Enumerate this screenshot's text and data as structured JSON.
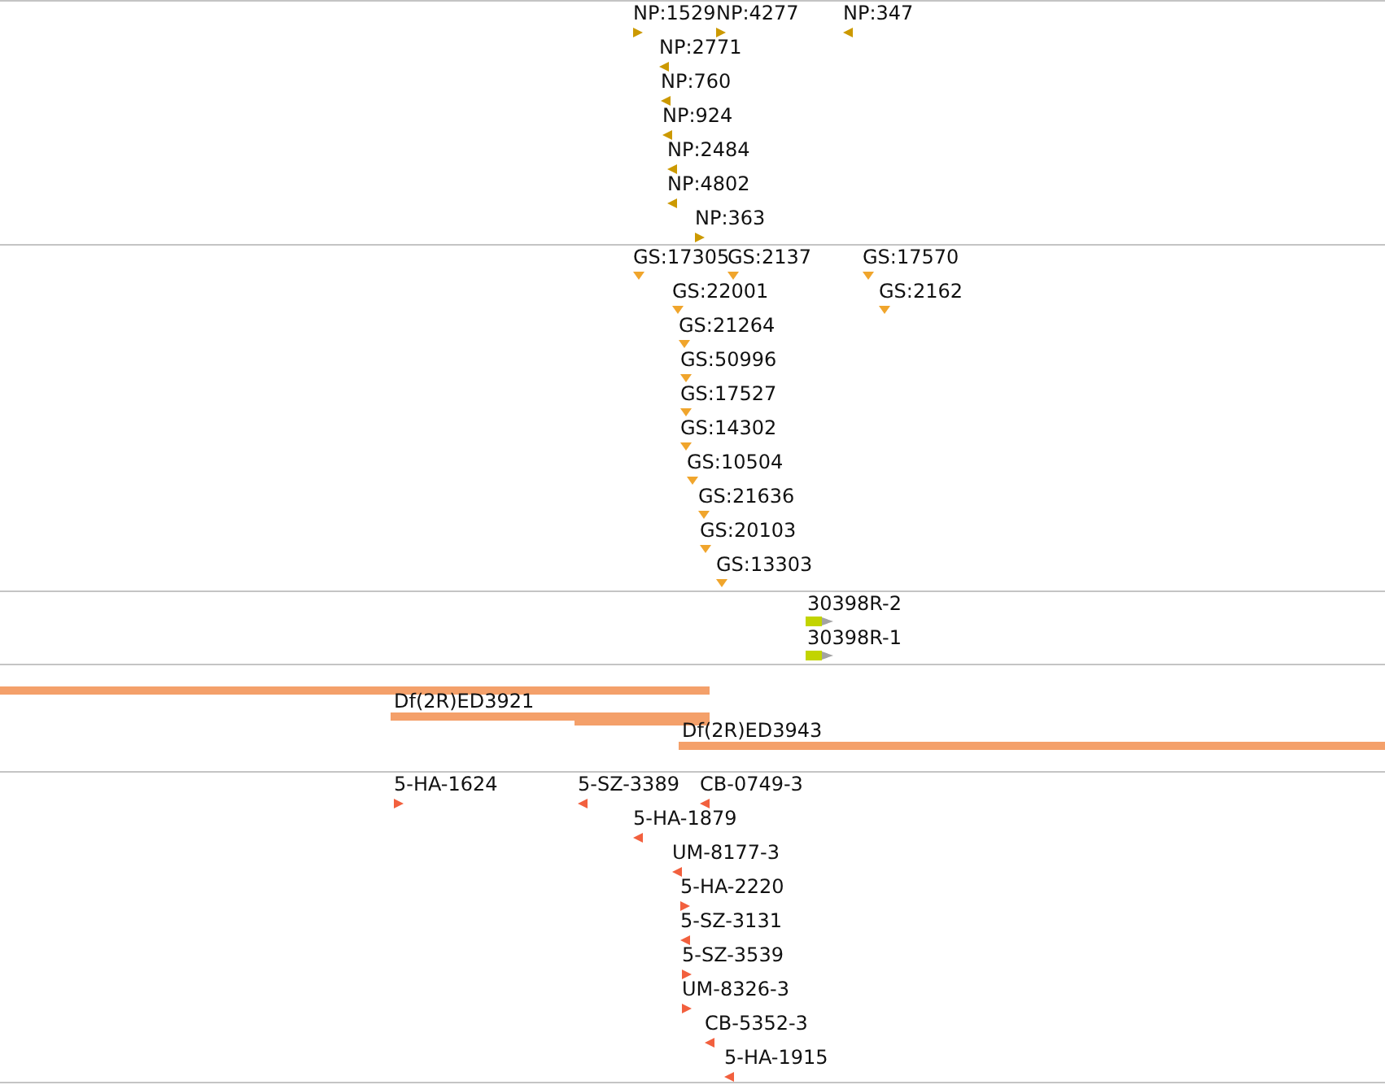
{
  "tracks": [
    {
      "kind": "stranded",
      "color": "#cc9900",
      "features": [
        {
          "label": "NP:1529",
          "reverse": false
        },
        {
          "label": "NP:4277",
          "reverse": false
        },
        {
          "label": "NP:347",
          "reverse": true
        },
        {
          "label": "NP:2771",
          "reverse": true
        },
        {
          "label": "NP:760",
          "reverse": true
        },
        {
          "label": "NP:924",
          "reverse": true
        },
        {
          "label": "NP:2484",
          "reverse": true
        },
        {
          "label": "NP:4802",
          "reverse": true
        },
        {
          "label": "NP:363",
          "reverse": false
        }
      ]
    },
    {
      "kind": "point",
      "color": "#f0a52c",
      "features": [
        {
          "label": "GS:17305"
        },
        {
          "label": "GS:2137"
        },
        {
          "label": "GS:17570"
        },
        {
          "label": "GS:22001"
        },
        {
          "label": "GS:2162"
        },
        {
          "label": "GS:21264"
        },
        {
          "label": "GS:50996"
        },
        {
          "label": "GS:17527"
        },
        {
          "label": "GS:14302"
        },
        {
          "label": "GS:10504"
        },
        {
          "label": "GS:21636"
        },
        {
          "label": "GS:20103"
        },
        {
          "label": "GS:13303"
        }
      ]
    },
    {
      "kind": "gene",
      "color": "#c2d400",
      "features": [
        {
          "label": "30398R-2",
          "reverse": false
        },
        {
          "label": "30398R-1",
          "reverse": false
        }
      ]
    },
    {
      "kind": "span",
      "color": "#f4a06a",
      "features": [
        {
          "kind": "bar"
        },
        {
          "kind": "bar",
          "label": "Df(2R)ED3921"
        },
        {
          "kind": "bar"
        },
        {
          "kind": "bar",
          "label": "Df(2R)ED3943"
        }
      ]
    },
    {
      "kind": "stranded",
      "color": "#f2603e",
      "features": [
        {
          "label": "5-HA-1624",
          "reverse": false
        },
        {
          "label": "5-SZ-3389",
          "reverse": true
        },
        {
          "label": "CB-0749-3",
          "reverse": true
        },
        {
          "label": "5-HA-1879",
          "reverse": true
        },
        {
          "label": "UM-8177-3",
          "reverse": true
        },
        {
          "label": "5-HA-2220",
          "reverse": false
        },
        {
          "label": "5-SZ-3131",
          "reverse": true
        },
        {
          "label": "5-SZ-3539",
          "reverse": false
        },
        {
          "label": "UM-8326-3",
          "reverse": false
        },
        {
          "label": "CB-5352-3",
          "reverse": true
        },
        {
          "label": "5-HA-1915",
          "reverse": true
        }
      ]
    }
  ]
}
